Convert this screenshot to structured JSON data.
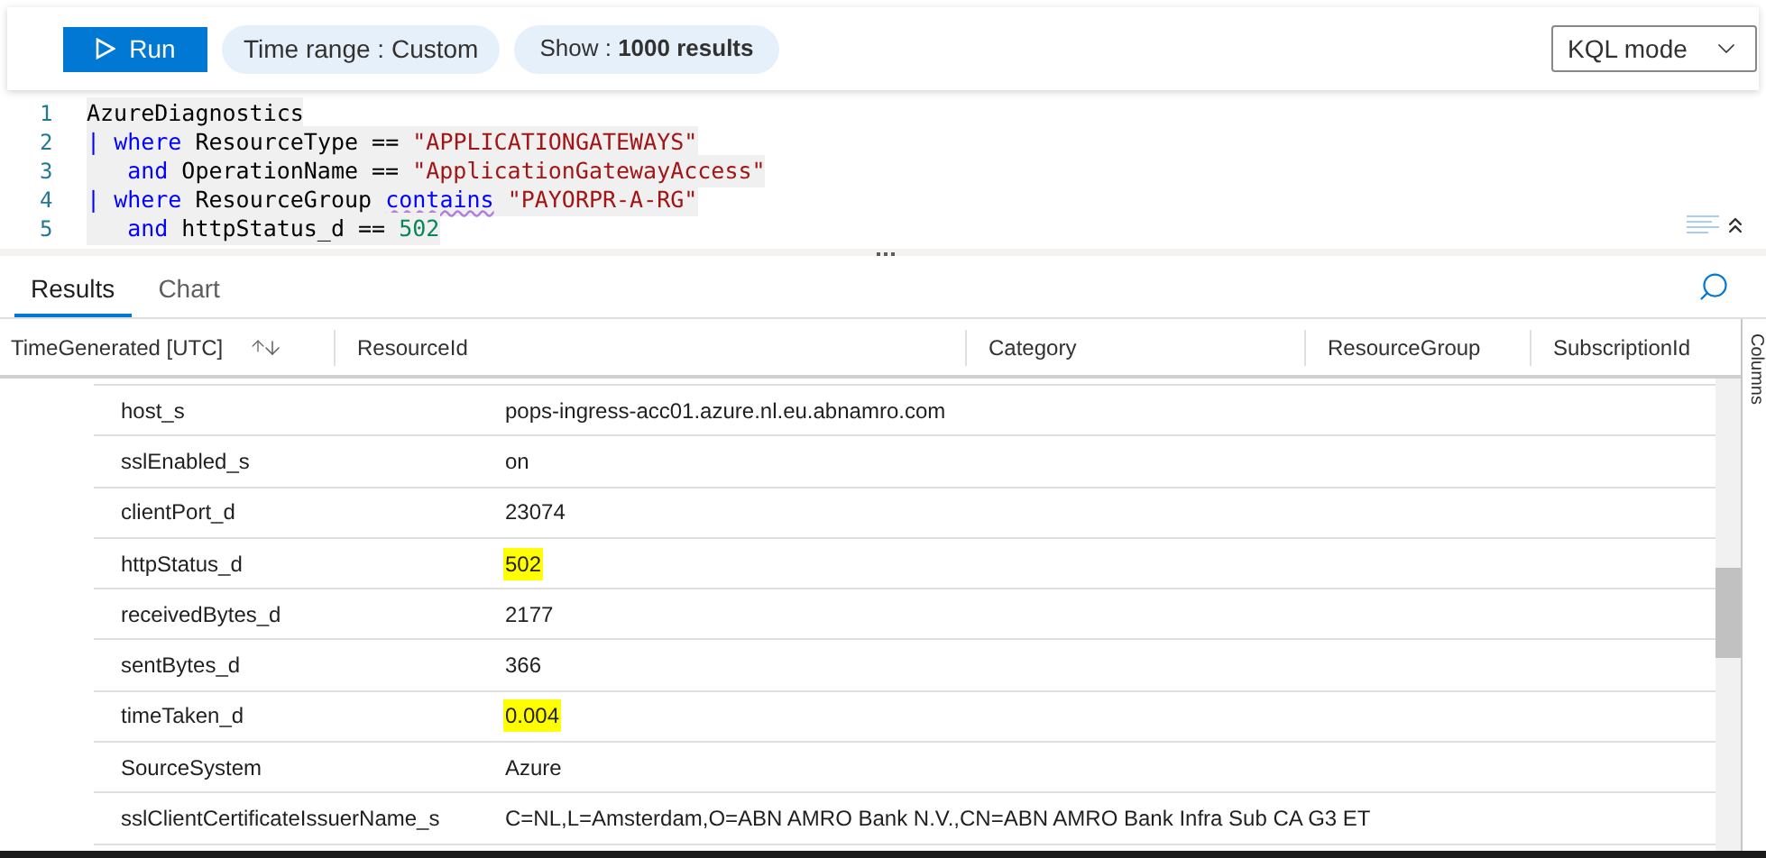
{
  "toolbar": {
    "run_label": "Run",
    "time_range": {
      "label": "Time range :",
      "value": "Custom"
    },
    "show": {
      "label": "Show :",
      "value": "1000 results"
    },
    "mode": "KQL mode"
  },
  "editor": {
    "lines": [
      {
        "number": "1",
        "tokens": [
          {
            "kind": "plain",
            "text": "AzureDiagnostics"
          }
        ]
      },
      {
        "number": "2",
        "tokens": [
          {
            "kind": "pipe",
            "text": "| "
          },
          {
            "kind": "keyword",
            "text": "where"
          },
          {
            "kind": "plain",
            "text": " ResourceType == "
          },
          {
            "kind": "string",
            "text": "\"APPLICATIONGATEWAYS\""
          }
        ]
      },
      {
        "number": "3",
        "indent": true,
        "tokens": [
          {
            "kind": "keyword",
            "text": "and"
          },
          {
            "kind": "plain",
            "text": " OperationName == "
          },
          {
            "kind": "string",
            "text": "\"ApplicationGatewayAccess\""
          }
        ]
      },
      {
        "number": "4",
        "tokens": [
          {
            "kind": "pipe",
            "text": "| "
          },
          {
            "kind": "keyword",
            "text": "where"
          },
          {
            "kind": "plain",
            "text": " ResourceGroup "
          },
          {
            "kind": "squiggle",
            "text": "contains"
          },
          {
            "kind": "string",
            "text": "\"PAYORPR-A-RG\"",
            "space_before": true
          }
        ]
      },
      {
        "number": "5",
        "indent": true,
        "tokens": [
          {
            "kind": "keyword",
            "text": "and"
          },
          {
            "kind": "plain",
            "text": " httpStatus_d == "
          },
          {
            "kind": "number",
            "text": "502"
          }
        ]
      }
    ]
  },
  "tabs": [
    {
      "label": "Results",
      "selected": true
    },
    {
      "label": "Chart",
      "selected": false
    }
  ],
  "table": {
    "columns": [
      "TimeGenerated [UTC]",
      "ResourceId",
      "Category",
      "ResourceGroup",
      "SubscriptionId"
    ],
    "rows": [
      {
        "name": "host_s",
        "value": "pops-ingress-acc01.azure.nl.eu.abnamro.com",
        "highlighted": false
      },
      {
        "name": "sslEnabled_s",
        "value": "on",
        "highlighted": false
      },
      {
        "name": "clientPort_d",
        "value": "23074",
        "highlighted": false
      },
      {
        "name": "httpStatus_d",
        "value": "502",
        "highlighted": true
      },
      {
        "name": "receivedBytes_d",
        "value": "2177",
        "highlighted": false
      },
      {
        "name": "sentBytes_d",
        "value": "366",
        "highlighted": false
      },
      {
        "name": "timeTaken_d",
        "value": "0.004",
        "highlighted": true
      },
      {
        "name": "SourceSystem",
        "value": "Azure",
        "highlighted": false
      },
      {
        "name": "sslClientCertificateIssuerName_s",
        "value": "C=NL,L=Amsterdam,O=ABN AMRO Bank N.V.,CN=ABN AMRO Bank Infra Sub CA G3 ET",
        "highlighted": false
      }
    ]
  },
  "side_panel": {
    "label": "Columns"
  }
}
